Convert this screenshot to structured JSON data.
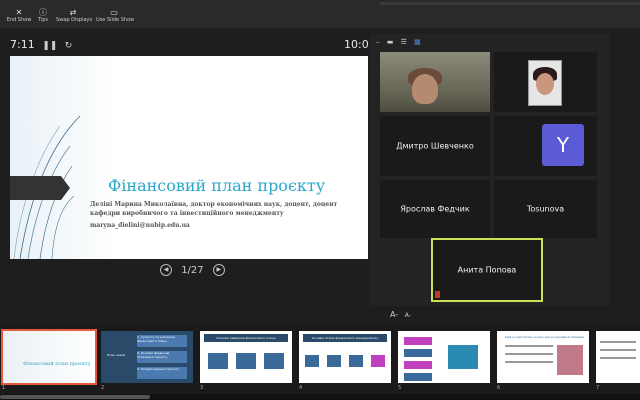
{
  "toolbar": {
    "end_show": "End Show",
    "tips": "Tips",
    "swap_displays": "Swap Displays",
    "use_slide_show": "Use Slide Show"
  },
  "presenter": {
    "timer": "7:11",
    "clock": "10:0",
    "slide_counter": "1/27"
  },
  "slide": {
    "title": "Фінансовий план проєкту",
    "author": "Деліні Марина Миколаївна, доктор економічних наук, доцент, доцент кафедри виробничого та інвестиційного менеджменту",
    "email": "maryna_dielini@nubip.edu.ua"
  },
  "participants": {
    "tile_3": "Дмитро Шевченко",
    "tile_4_initial": "Y",
    "tile_5": "Ярослав Федчик",
    "tile_6": "Tosunova",
    "tile_7": "Анита Попова"
  },
  "font_controls": {
    "increase": "A-",
    "decrease": "A-"
  },
  "thumbnails": [
    {
      "number": "1",
      "title": "Фінансовий план проєкту"
    },
    {
      "number": "2",
      "items": [
        "1. Сутність та значення фінансового плану",
        "2. Основні фінансові показники проєкту",
        "3. Оподаткування проєкту"
      ],
      "label": "План лекції"
    },
    {
      "number": "3",
      "title": "Основні завдання фінансового плану"
    },
    {
      "number": "4",
      "title": "Основні етапи фінансового менеджменту"
    },
    {
      "number": "5"
    },
    {
      "number": "6",
      "title": "Цей розділ бізнес-плану має розкривати питання"
    },
    {
      "number": "7"
    }
  ]
}
